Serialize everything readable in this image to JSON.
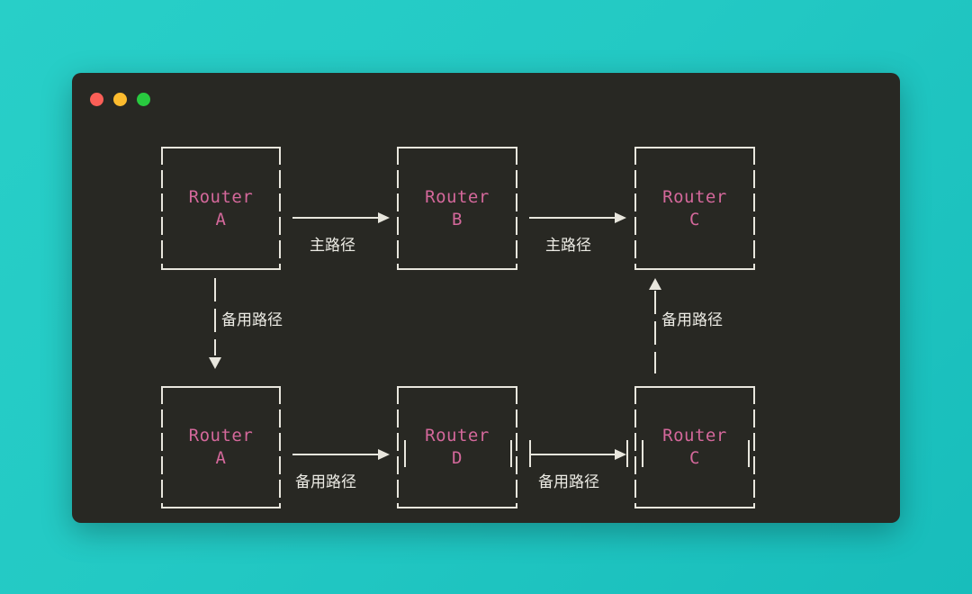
{
  "window": {
    "background_color": "#282823",
    "page_background_color": "#23c9c4",
    "traffic_lights": [
      {
        "name": "close",
        "color": "#fb5f57"
      },
      {
        "name": "minimize",
        "color": "#fcbb2e"
      },
      {
        "name": "maximize",
        "color": "#28c93f"
      }
    ]
  },
  "diagram": {
    "node_text_color": "#d4689b",
    "line_color": "#e8e6dd",
    "nodes": [
      {
        "id": "a1",
        "line1": "Router",
        "line2": "A"
      },
      {
        "id": "b1",
        "line1": "Router",
        "line2": "B"
      },
      {
        "id": "c1",
        "line1": "Router",
        "line2": "C"
      },
      {
        "id": "a2",
        "line1": "Router",
        "line2": "A"
      },
      {
        "id": "d2",
        "line1": "Router",
        "line2": "D"
      },
      {
        "id": "c2",
        "line1": "Router",
        "line2": "C"
      }
    ],
    "edges": [
      {
        "id": "a1-b1",
        "label": "主路径",
        "direction": "right"
      },
      {
        "id": "b1-c1",
        "label": "主路径",
        "direction": "right"
      },
      {
        "id": "a1-a2",
        "label": "备用路径",
        "direction": "down"
      },
      {
        "id": "a2-d2",
        "label": "备用路径",
        "direction": "right"
      },
      {
        "id": "d2-c2",
        "label": "备用路径",
        "direction": "right"
      },
      {
        "id": "c2-c1",
        "label": "备用路径",
        "direction": "up"
      }
    ]
  }
}
